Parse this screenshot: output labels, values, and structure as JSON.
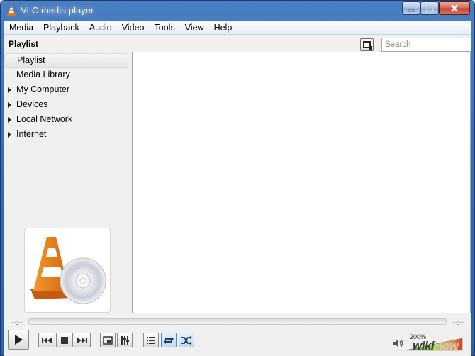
{
  "window": {
    "title": "VLC media player",
    "controls": {
      "minimize": "minimize",
      "maximize": "maximize",
      "close": "close"
    }
  },
  "menu": [
    {
      "label": "Media"
    },
    {
      "label": "Playback"
    },
    {
      "label": "Audio"
    },
    {
      "label": "Video"
    },
    {
      "label": "Tools"
    },
    {
      "label": "View"
    },
    {
      "label": "Help"
    }
  ],
  "playlist": {
    "header": "Playlist",
    "search_placeholder": "Search"
  },
  "sidebar": {
    "items": [
      {
        "label": "Playlist",
        "selected": true,
        "expandable": false
      },
      {
        "label": "Media Library",
        "selected": false,
        "expandable": false
      },
      {
        "label": "My Computer",
        "selected": false,
        "expandable": true
      },
      {
        "label": "Devices",
        "selected": false,
        "expandable": true
      },
      {
        "label": "Local Network",
        "selected": false,
        "expandable": true
      },
      {
        "label": "Internet",
        "selected": false,
        "expandable": true
      }
    ]
  },
  "player": {
    "elapsed": "--:--",
    "remaining": "--:--",
    "seek_position": 0,
    "volume_percent_label": "200%",
    "volume_level": 1.0
  },
  "controls": [
    {
      "name": "play-button",
      "icon": "play-icon"
    },
    {
      "name": "previous-button",
      "icon": "skip-back-icon"
    },
    {
      "name": "stop-button",
      "icon": "stop-icon"
    },
    {
      "name": "next-button",
      "icon": "skip-forward-icon"
    },
    {
      "name": "fullscreen-button",
      "icon": "fullscreen-icon"
    },
    {
      "name": "extended-settings-button",
      "icon": "equalizer-icon"
    },
    {
      "name": "playlist-toggle-button",
      "icon": "list-icon"
    },
    {
      "name": "loop-button",
      "icon": "loop-icon"
    },
    {
      "name": "random-button",
      "icon": "shuffle-icon"
    }
  ],
  "watermark": {
    "wiki": "wiki",
    "how": "How"
  },
  "colors": {
    "titlebar": "#3a6db5",
    "accent_active": "#bcdcf3",
    "cone_orange": "#e8761b",
    "volume_green": "#3fae3f",
    "volume_red": "#d63a2a"
  }
}
